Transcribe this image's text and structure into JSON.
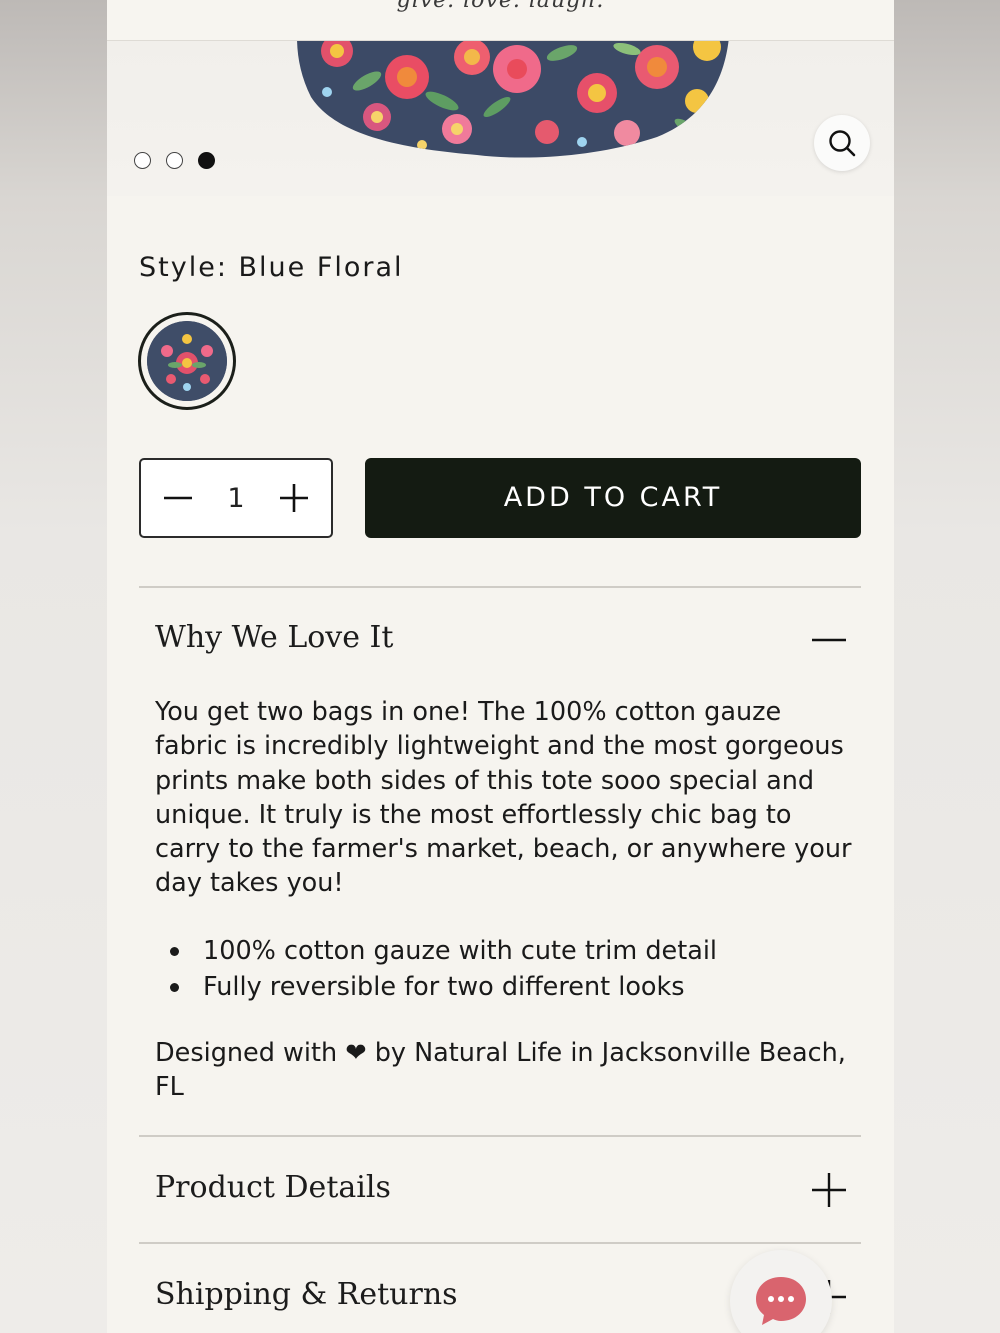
{
  "header": {
    "logo_text": "give. love. laugh."
  },
  "gallery": {
    "dots": [
      {
        "active": false
      },
      {
        "active": false
      },
      {
        "active": true
      }
    ],
    "zoom_icon": "search-icon"
  },
  "style": {
    "label": "Style:",
    "value": "Blue Floral",
    "swatch_icon": "blue-floral-swatch"
  },
  "quantity": {
    "value": "1",
    "decrement_icon": "minus-icon",
    "increment_icon": "plus-icon"
  },
  "cart": {
    "label": "ADD TO CART"
  },
  "accordions": [
    {
      "title": "Why We Love It",
      "icon": "minus-icon",
      "expanded": true
    },
    {
      "title": "Product Details",
      "icon": "plus-icon",
      "expanded": false
    },
    {
      "title": "Shipping & Returns",
      "icon": "plus-icon",
      "expanded": false
    }
  ],
  "why": {
    "description": "You get two bags in one! The 100% cotton gauze fabric is incredibly lightweight and the most gorgeous prints make both sides of this tote sooo special and unique. It truly is the most effortlessly chic bag to carry to the farmer's market, beach, or anywhere your day takes you!",
    "bullets": [
      "100% cotton gauze with cute trim detail",
      "Fully reversible for two different looks"
    ],
    "designed_prefix": "Designed with",
    "designed_heart": "❤",
    "designed_suffix": "by Natural Life in Jacksonville Beach, FL"
  },
  "chat": {
    "icon": "chat-bubble-icon",
    "color": "#d9646e"
  }
}
